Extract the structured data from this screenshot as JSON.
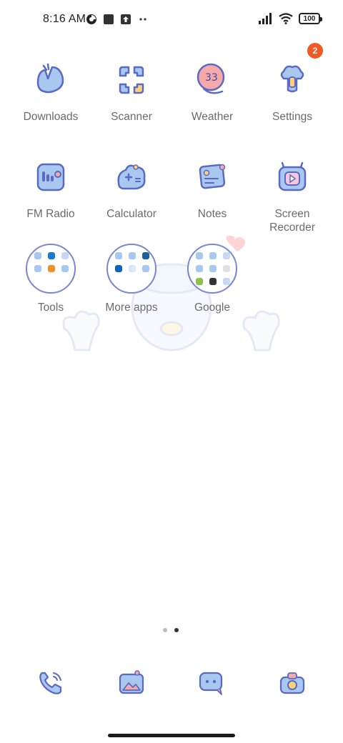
{
  "status_bar": {
    "time": "8:16 AM",
    "battery": "100",
    "left_icons": [
      "data-saver-icon",
      "square-notification-icon",
      "upload-notification-icon",
      "more-dots-icon"
    ],
    "right_icons": [
      "signal-icon",
      "wifi-icon",
      "battery-icon"
    ]
  },
  "apps": [
    {
      "label": "Downloads",
      "icon": "downloads-icon"
    },
    {
      "label": "Scanner",
      "icon": "scanner-icon"
    },
    {
      "label": "Weather",
      "icon": "weather-icon"
    },
    {
      "label": "Settings",
      "icon": "settings-icon",
      "badge": "2"
    },
    {
      "label": "FM Radio",
      "icon": "radio-icon"
    },
    {
      "label": "Calculator",
      "icon": "calculator-icon"
    },
    {
      "label": "Notes",
      "icon": "notes-icon"
    },
    {
      "label": "Screen\nRecorder",
      "icon": "screen-recorder-icon"
    },
    {
      "label": "Tools",
      "icon": "folder-icon"
    },
    {
      "label": "More apps",
      "icon": "folder-icon"
    },
    {
      "label": "Google",
      "icon": "folder-icon"
    }
  ],
  "weather_temp": "33",
  "pager": {
    "pages": 2,
    "current": 2
  },
  "dock": [
    {
      "icon": "phone-icon"
    },
    {
      "icon": "gallery-icon"
    },
    {
      "icon": "messages-icon"
    },
    {
      "icon": "camera-icon"
    }
  ],
  "colors": {
    "accent": "#7b86d6",
    "icon_fill": "#a9c8f0",
    "badge": "#f15a24"
  }
}
